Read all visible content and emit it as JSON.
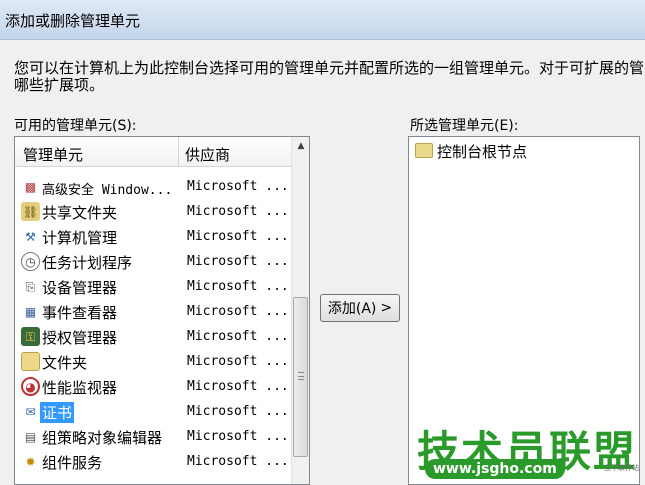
{
  "window": {
    "title": "添加或删除管理单元"
  },
  "description": "您可以在计算机上为此控制台选择可用的管理单元并配置所选的一组管理单元。对于可扩展的管理单元，您可以配置要启用哪些扩展项。",
  "description_line2": "哪些扩展项。",
  "available": {
    "label": "可用的管理单元(S):",
    "col_name": "管理单元",
    "col_vendor": "供应商",
    "items": [
      {
        "icon": "firewall-icon",
        "name": "高级安全 Window...",
        "vendor": "Microsoft ..."
      },
      {
        "icon": "shared-folder-icon",
        "name": "共享文件夹",
        "vendor": "Microsoft ..."
      },
      {
        "icon": "computer-management-icon",
        "name": "计算机管理",
        "vendor": "Microsoft ..."
      },
      {
        "icon": "clock-icon",
        "name": "任务计划程序",
        "vendor": "Microsoft ..."
      },
      {
        "icon": "device-manager-icon",
        "name": "设备管理器",
        "vendor": "Microsoft ..."
      },
      {
        "icon": "event-viewer-icon",
        "name": "事件查看器",
        "vendor": "Microsoft ..."
      },
      {
        "icon": "authorization-manager-icon",
        "name": "授权管理器",
        "vendor": "Microsoft ..."
      },
      {
        "icon": "folder-icon",
        "name": "文件夹",
        "vendor": "Microsoft ..."
      },
      {
        "icon": "performance-monitor-icon",
        "name": "性能监视器",
        "vendor": "Microsoft ..."
      },
      {
        "icon": "certificate-icon",
        "name": "证书",
        "vendor": "Microsoft ..."
      },
      {
        "icon": "group-policy-icon",
        "name": "组策略对象编辑器",
        "vendor": "Microsoft ..."
      },
      {
        "icon": "component-services-icon",
        "name": "组件服务",
        "vendor": "Microsoft ..."
      }
    ],
    "selected_index": 9
  },
  "add_button": {
    "label": "添加(A)",
    "arrow": ">"
  },
  "selected": {
    "label": "所选管理单元(E):",
    "root": {
      "icon": "folder-icon",
      "name": "控制台根节点"
    }
  },
  "watermark": {
    "text": "技术员联盟",
    "url": "www.jsgho.com",
    "small": "立下软件站"
  },
  "colors": {
    "selection": "#3399ff",
    "watermark": "#2a9a2a"
  }
}
